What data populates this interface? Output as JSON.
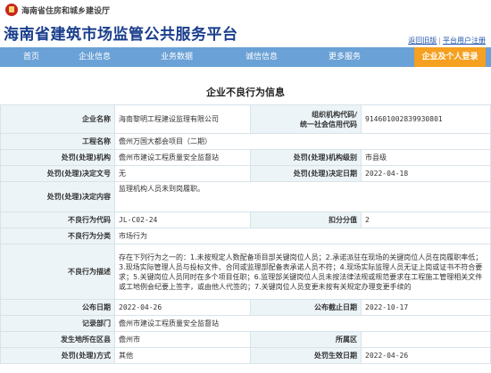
{
  "header": {
    "dept_name": "海南省住房和城乡建设厅",
    "site_title": "海南省建筑市场监管公共服务平台",
    "links": [
      "返回旧版",
      "平台用户注册"
    ]
  },
  "nav": {
    "items": [
      "首页",
      "企业信息",
      "业务数据",
      "诚信信息",
      "更多服务"
    ],
    "special": "企业及个人登录"
  },
  "page": {
    "title": "企业不良行为信息"
  },
  "detail": {
    "company_name_label": "企业名称",
    "company_name": "海南黎明工程建设监理有限公司",
    "org_code_label_1": "组织机构代码/",
    "org_code_label_2": "统一社会信用代码",
    "org_code": "914601002839930801",
    "project_label": "工程名称",
    "project": "儋州万国大都会项目（二期）",
    "handler_label": "处罚(处理)机构",
    "handler": "儋州市建设工程质量安全监督站",
    "handler_level_label": "处罚(处理)机构级别",
    "handler_level": "市县级",
    "decision_no_label": "处罚(处理)决定文号",
    "decision_no": "无",
    "decision_date_label": "处罚(处理)决定日期",
    "decision_date": "2022-04-18",
    "decision_content_label": "处罚(处理)决定内容",
    "decision_content": "监理机构人员未到岗履职。",
    "code_label": "不良行为代码",
    "code": "JL-C02-24",
    "score_label": "扣分分值",
    "score": "2",
    "category_label": "不良行为分类",
    "category": "市场行为",
    "description_label": "不良行为描述",
    "description": "存在下列行为之一的：1.未按规定人数配备项目部关键岗位人员；2.承诺派驻在现场的关键岗位人员在岗履职率低；3.现场实际管理人员与投标文件、合同或监理部配备表承诺人员不符；4.现场实际监理人员无证上岗或证书不符合要求；5.关键岗位人员同时在多个项目任职；6.监理部关键岗位人员未按法律法规或规范要求在工程施工管理相关文件或工地例会纪要上签字，或由他人代签的；7.关键岗位人员变更未按有关规定办理变更手续的",
    "publish_date_label": "公布日期",
    "publish_date": "2022-04-26",
    "publish_end_label": "公布截止日期",
    "publish_end": "2022-10-17",
    "recorder_label": "记录部门",
    "recorder": "儋州市建设工程质量安全监督站",
    "location_label": "发生地所在区县",
    "location": "儋州市",
    "district_label": "所属区",
    "district": "",
    "action_type_label": "处罚(处理)方式",
    "action_type": "其他",
    "effective_date_label": "处罚生效日期",
    "effective_date": "2022-04-26"
  }
}
